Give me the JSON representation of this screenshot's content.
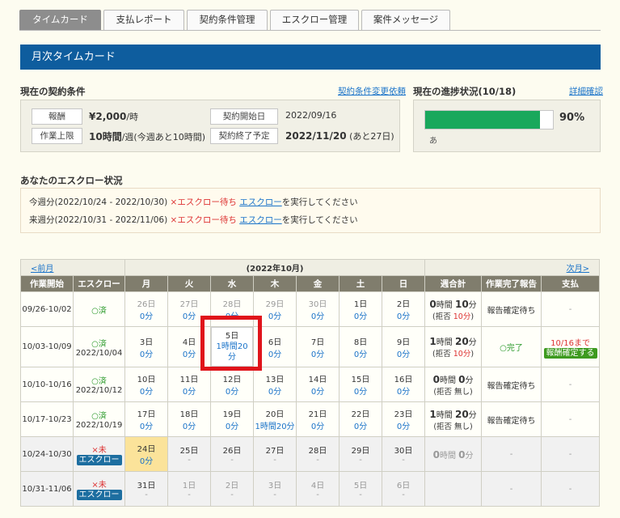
{
  "tabs": [
    "タイムカード",
    "支払レポート",
    "契約条件管理",
    "エスクロー管理",
    "案件メッセージ"
  ],
  "banner_title": "月次タイムカード",
  "contract": {
    "title": "現在の契約条件",
    "change_link": "契約条件変更依頼",
    "reward_label": "報酬",
    "reward_value": "¥2,000",
    "reward_unit": "/時",
    "limit_label": "作業上限",
    "limit_value": "10時間",
    "limit_note": "/週(今週あと10時間)",
    "start_label": "契約開始日",
    "start_value": "2022/09/16",
    "end_label": "契約終了予定",
    "end_value": "2022/11/20",
    "end_note": "(あと27日)"
  },
  "progress": {
    "title": "現在の進捗状況(10/18)",
    "detail_link": "詳細確認",
    "percent_label": "90%",
    "percent": 90,
    "note": "あ"
  },
  "escrow_status": {
    "title": "あなたのエスクロー状況",
    "lines": [
      {
        "period": "今週分(2022/10/24 - 2022/10/30)",
        "status": "×エスクロー待ち",
        "link": "エスクロー",
        "suffix": "を実行してください"
      },
      {
        "period": "来週分(2022/10/31 - 2022/11/06)",
        "status": "×エスクロー待ち",
        "link": "エスクロー",
        "suffix": "を実行してください"
      }
    ]
  },
  "calendar": {
    "prev": "<前月",
    "title": "(2022年10月)",
    "next": "次月>",
    "headers": [
      "作業開始",
      "エスクロー",
      "月",
      "火",
      "水",
      "木",
      "金",
      "土",
      "日",
      "週合計",
      "作業完了報告",
      "支払"
    ],
    "rows": [
      {
        "week": "09/26-10/02",
        "escrow": "○済",
        "escrow_date": "",
        "days": [
          [
            "26日",
            "0分"
          ],
          [
            "27日",
            "0分"
          ],
          [
            "28日",
            "0分"
          ],
          [
            "29日",
            "0分"
          ],
          [
            "30日",
            "0分"
          ],
          [
            "1日",
            "0分"
          ],
          [
            "2日",
            "0分"
          ]
        ],
        "sum_h": "0",
        "sum_m": "10",
        "sum_note": "(拒否 ",
        "sum_note_red": "10分",
        "sum_note_end": ")",
        "report": "報告確定待ち",
        "pay": "-"
      },
      {
        "week": "10/03-10/09",
        "escrow": "○済",
        "escrow_date": "2022/10/04",
        "days": [
          [
            "3日",
            "0分"
          ],
          [
            "4日",
            "0分"
          ],
          [
            "5日",
            "1時間20分"
          ],
          [
            "6日",
            "0分"
          ],
          [
            "7日",
            "0分"
          ],
          [
            "8日",
            "0分"
          ],
          [
            "9日",
            "0分"
          ]
        ],
        "sum_h": "1",
        "sum_m": "20",
        "sum_note": "(拒否 ",
        "sum_note_red": "10分",
        "sum_note_end": ")",
        "report": "○完了",
        "pay": "10/16まで",
        "pay_button": "報酬確定する"
      },
      {
        "week": "10/10-10/16",
        "escrow": "○済",
        "escrow_date": "2022/10/12",
        "days": [
          [
            "10日",
            "0分"
          ],
          [
            "11日",
            "0分"
          ],
          [
            "12日",
            "0分"
          ],
          [
            "13日",
            "0分"
          ],
          [
            "14日",
            "0分"
          ],
          [
            "15日",
            "0分"
          ],
          [
            "16日",
            "0分"
          ]
        ],
        "sum_h": "0",
        "sum_m": "0",
        "sum_note": "(拒否 無し)",
        "sum_note_red": "",
        "sum_note_end": "",
        "report": "報告確定待ち",
        "pay": "-"
      },
      {
        "week": "10/17-10/23",
        "escrow": "○済",
        "escrow_date": "2022/10/19",
        "days": [
          [
            "17日",
            "0分"
          ],
          [
            "18日",
            "0分"
          ],
          [
            "19日",
            "0分"
          ],
          [
            "20日",
            "1時間20分"
          ],
          [
            "21日",
            "0分"
          ],
          [
            "22日",
            "0分"
          ],
          [
            "23日",
            "0分"
          ]
        ],
        "sum_h": "1",
        "sum_m": "20",
        "sum_note": "(拒否 無し)",
        "sum_note_red": "",
        "sum_note_end": "",
        "report": "報告確定待ち",
        "pay": "-"
      },
      {
        "week": "10/24-10/30",
        "escrow": "×未",
        "escrow_button": "エスクロー",
        "days": [
          [
            "24日",
            "0分"
          ],
          [
            "25日",
            "-"
          ],
          [
            "26日",
            "-"
          ],
          [
            "27日",
            "-"
          ],
          [
            "28日",
            "-"
          ],
          [
            "29日",
            "-"
          ],
          [
            "30日",
            "-"
          ]
        ],
        "sum_h": "0",
        "sum_m": "0",
        "report": "-",
        "pay": "-"
      },
      {
        "week": "10/31-11/06",
        "escrow": "×未",
        "escrow_button": "エスクロー",
        "days": [
          [
            "31日",
            "-"
          ],
          [
            "1日",
            "-"
          ],
          [
            "2日",
            "-"
          ],
          [
            "3日",
            "-"
          ],
          [
            "4日",
            "-"
          ],
          [
            "5日",
            "-"
          ],
          [
            "6日",
            "-"
          ]
        ],
        "report": "-",
        "pay": "-"
      }
    ]
  }
}
